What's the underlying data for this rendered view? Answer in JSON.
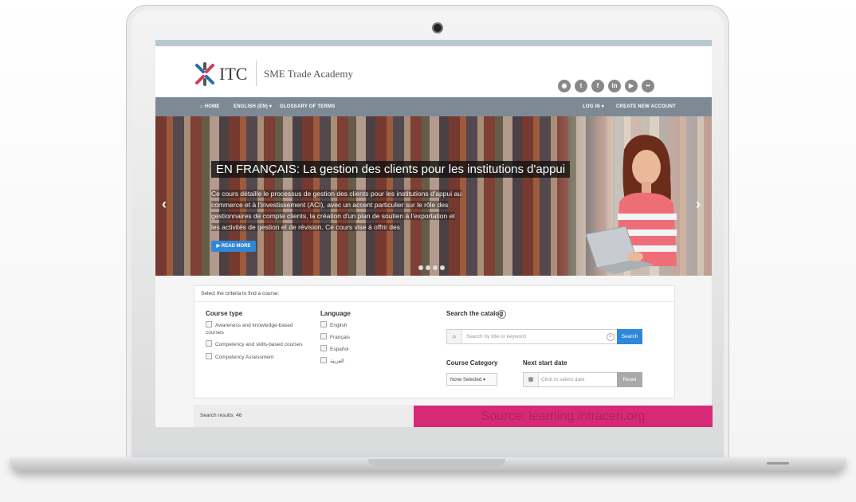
{
  "header": {
    "logo_text": "ITC",
    "site_name": "SME Trade Academy",
    "social_icons": [
      "rss-icon",
      "twitter-icon",
      "facebook-icon",
      "linkedin-icon",
      "youtube-icon",
      "flickr-icon"
    ]
  },
  "nav": {
    "home": "HOME",
    "language": "ENGLISH (EN) ▾",
    "glossary": "GLOSSARY OF TERMS",
    "login": "LOG IN ▾",
    "create_account": "CREATE NEW ACCOUNT"
  },
  "hero": {
    "title": "EN FRANÇAIS: La gestion des clients pour les institutions d'appui",
    "description": "Ce cours détaille le processus de gestion des clients pour les institutions d'appui au commerce et à l'investissement (ACI), avec un accent particulier sur le rôle des gestionnaires de compte clients, la création d'un plan de soutien à l'exportation et les activités de gestion et de révision. Ce cours vise à offrir des",
    "read_more": "▶ READ MORE"
  },
  "filters": {
    "heading": "Select the criteria to find a course:",
    "course_type": {
      "title": "Course type",
      "options": [
        "Awareness and knowledge-based courses",
        "Competency and skills-based courses",
        "Competency Assessment"
      ]
    },
    "language": {
      "title": "Language",
      "options": [
        "English",
        "Français",
        "Español",
        "العربية"
      ]
    },
    "search": {
      "title": "Search the catalog",
      "placeholder": "Search by title or keyword",
      "button": "Search"
    },
    "category": {
      "title": "Course Category",
      "selected": "None Selected ▾"
    },
    "start_date": {
      "title": "Next start date",
      "placeholder": "Click to select date",
      "reset": "Reset"
    }
  },
  "results": {
    "label": "Search results: 46"
  },
  "source": {
    "label": "Source: learning.intracen.org"
  },
  "colors": {
    "nav_bg": "#7d8a96",
    "accent_blue": "#2f87d8",
    "source_pink": "#d62a79"
  }
}
